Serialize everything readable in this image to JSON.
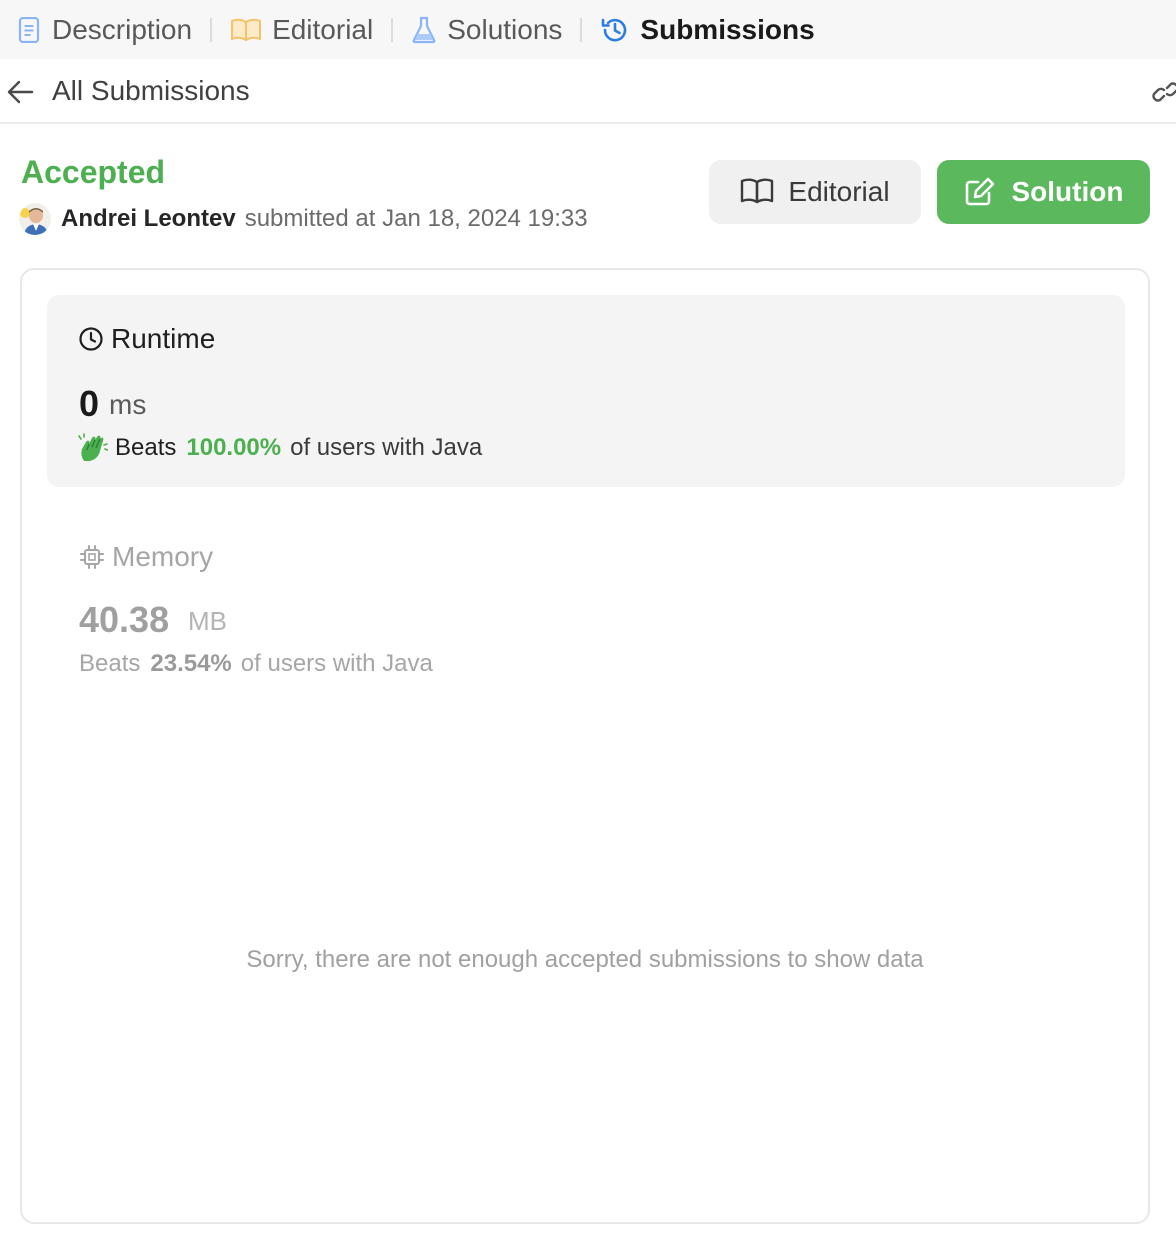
{
  "tabs": [
    {
      "label": "Description",
      "icon": "description-icon",
      "color": "#8ab4f8"
    },
    {
      "label": "Editorial",
      "icon": "book-icon",
      "color": "#f5c26b"
    },
    {
      "label": "Solutions",
      "icon": "flask-icon",
      "color": "#8ab4f8"
    },
    {
      "label": "Submissions",
      "icon": "history-icon",
      "color": "#2d7de0",
      "active": true
    }
  ],
  "subheader": {
    "title": "All Submissions"
  },
  "submission": {
    "status": "Accepted",
    "status_color": "#4caf50",
    "user": "Andrei Leontev",
    "submitted_text": "submitted at Jan 18, 2024 19:33"
  },
  "actions": {
    "editorial_label": "Editorial",
    "solution_label": "Solution",
    "solution_color": "#5cb85c"
  },
  "runtime": {
    "title": "Runtime",
    "value": "0",
    "unit": "ms",
    "beats_label": "Beats",
    "beats_pct": "100.00%",
    "beats_suffix": "of users with Java"
  },
  "memory": {
    "title": "Memory",
    "value": "40.38",
    "unit": "MB",
    "beats_label": "Beats",
    "beats_pct": "23.54%",
    "beats_suffix": "of users with Java"
  },
  "empty_message": "Sorry, there are not enough accepted submissions to show data"
}
